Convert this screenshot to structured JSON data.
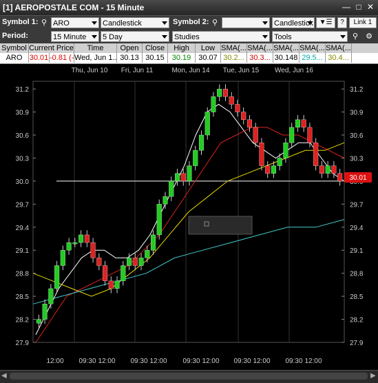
{
  "window": {
    "title": "[1] AEROPOSTALE COM - 15 Minute",
    "link_label": "Link 1",
    "help_label": "?"
  },
  "toolbar1": {
    "symbol1_label": "Symbol 1:",
    "symbol1_value": "ARO",
    "chart_type_1": "Candlestick",
    "symbol2_label": "Symbol 2:",
    "symbol2_value": "",
    "chart_type_2": "Candlestick"
  },
  "toolbar2": {
    "period_label": "Period:",
    "interval": "15 Minute",
    "range": "5 Day",
    "studies": "Studies",
    "tools": "Tools"
  },
  "quote": {
    "headers": [
      "Symbol",
      "Current Price",
      "Time",
      "Open",
      "Close",
      "High",
      "Low",
      "SMA(...",
      "SMA(...",
      "SMA(...",
      "SMA(...",
      "SMA(..."
    ],
    "row": [
      "ARO",
      "30.01",
      "-0.81 (-...",
      "Wed, Jun 1...",
      "30.13",
      "30.15",
      "30.19",
      "30.07",
      "30.2...",
      "30.3...",
      "30.148",
      "29.5...",
      "30.4..."
    ]
  },
  "chart": {
    "date_labels": [
      "Thu, Jun 10",
      "Fri, Jun 11",
      "Mon, Jun 14",
      "Tue, Jun 15",
      "Wed, Jun 16"
    ],
    "time_labels": [
      "12:00",
      "09:30",
      "12:00",
      "09:30",
      "12:00",
      "09:30",
      "12:00",
      "09:30",
      "12:00",
      "09:30",
      "12:00"
    ],
    "current_price_label": "30.01"
  },
  "chart_data": {
    "type": "line",
    "title": "",
    "xlabel": "",
    "ylabel": "",
    "ylim": [
      27.9,
      31.3
    ],
    "yticks": [
      27.9,
      28.2,
      28.5,
      28.8,
      29.1,
      29.4,
      29.7,
      30.0,
      30.3,
      30.6,
      30.9,
      31.2
    ],
    "reference_line": 30.0,
    "last_price": 30.01,
    "colors": {
      "up": "#22cc22",
      "down": "#dd2222",
      "sma_white": "#ffffff",
      "sma_red": "#dd2222",
      "sma_yellow": "#e6d800",
      "sma_cyan": "#44cccc"
    },
    "price_close": [
      28.2,
      28.4,
      28.6,
      28.9,
      29.1,
      29.2,
      29.2,
      29.3,
      29.2,
      29.0,
      28.9,
      28.7,
      28.6,
      28.7,
      28.9,
      29.0,
      28.9,
      29.0,
      29.1,
      29.3,
      29.7,
      29.8,
      30.0,
      30.1,
      30.0,
      30.2,
      30.4,
      30.6,
      30.9,
      31.1,
      31.2,
      31.1,
      31.0,
      30.9,
      30.8,
      30.7,
      30.5,
      30.2,
      30.1,
      30.2,
      30.3,
      30.5,
      30.7,
      30.8,
      30.7,
      30.5,
      30.2,
      30.1,
      30.2,
      30.1,
      30.0
    ],
    "series": [
      {
        "name": "SMA(...",
        "color": "white",
        "values": [
          28.0,
          28.3,
          28.6,
          28.8,
          29.0,
          29.1,
          29.1,
          29.0,
          29.0,
          29.1,
          29.3,
          29.6,
          29.9,
          30.2,
          30.6,
          30.9,
          31.0,
          30.9,
          30.7,
          30.5,
          30.4,
          30.3,
          30.4,
          30.5,
          30.5,
          30.3,
          30.1,
          30.0
        ]
      },
      {
        "name": "SMA(...",
        "color": "red",
        "values": [
          27.9,
          28.2,
          28.5,
          28.6,
          28.7,
          28.8,
          28.9,
          29.1,
          29.3,
          29.6,
          29.9,
          30.2,
          30.5,
          30.6,
          30.7,
          30.7,
          30.6,
          30.6,
          30.5,
          30.4,
          30.3
        ]
      },
      {
        "name": "SMA(...",
        "color": "yellow",
        "values": [
          28.8,
          28.7,
          28.6,
          28.5,
          28.6,
          28.8,
          29.0,
          29.3,
          29.6,
          29.8,
          30.0,
          30.1,
          30.2,
          30.3,
          30.4,
          30.4,
          30.5
        ]
      },
      {
        "name": "SMA(...",
        "color": "cyan",
        "values": [
          28.4,
          28.5,
          28.6,
          28.7,
          28.8,
          29.0,
          29.1,
          29.2,
          29.3,
          29.4,
          29.4,
          29.5
        ]
      }
    ]
  }
}
